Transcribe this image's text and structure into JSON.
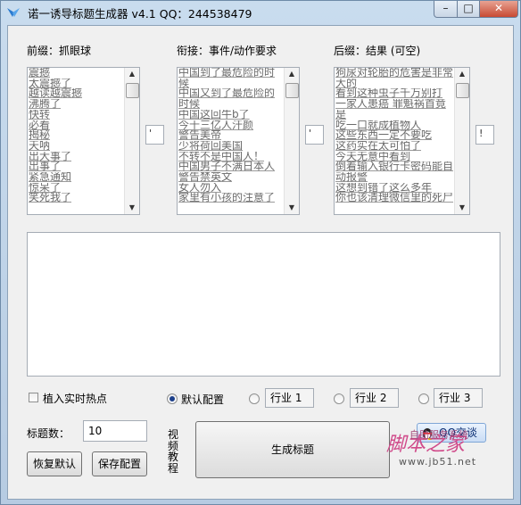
{
  "window": {
    "title": "诺一诱导标题生成器 v4.1    QQ：244538479",
    "close_glyph": "✕",
    "minimize_glyph": "–",
    "maximize_glyph": "□"
  },
  "prefix": {
    "label": "前缀：抓眼球",
    "items": [
      "震撼",
      "太震撼了",
      "越读越震撼",
      "沸腾了",
      "快转",
      "必看",
      "揭秘",
      "天呐",
      "出大事了",
      "出事了",
      "紧急通知",
      "惊呆了",
      "笑死我了"
    ],
    "side_value": "'"
  },
  "middle": {
    "label": "衔接：事件/动作要求",
    "items": [
      "中国到了最危险的时",
      "候",
      "中国又到了最危险的",
      "时候",
      "中国这回牛b了",
      "今十三亿人汗颜",
      "警告美帝",
      "少将荷回美国",
      "不转不是中国人！",
      "中国男子不满日本人",
      "警告禁英文",
      "女人勿入",
      "家里有小孩的注意了"
    ],
    "side_value": "'"
  },
  "suffix": {
    "label": "后缀：结果 (可空)",
    "items": [
      "狗尿对轮胎的危害是非常",
      "大的",
      "看到这种虫子千万别打",
      "一家人患癌 罪魁祸首竟",
      "是",
      "吃一口就成植物人",
      "这些东西一定不要吃",
      "这药实在太可怕了",
      "今天无意中看到",
      "倒着输入银行卡密码能自",
      "动报警",
      "这想到错了这么多年",
      "你也该清理微信里的死尸"
    ],
    "side_value": "!"
  },
  "options": {
    "realtime_hot": "植入实时热点",
    "default_config": "默认配置",
    "industry": [
      "行业 1",
      "行业 2",
      "行业 3"
    ]
  },
  "title_count": {
    "label": "标题数：",
    "value": "10"
  },
  "buttons": {
    "restore": "恢复默认",
    "save": "保存配置",
    "generate": "生成标题",
    "qq_chat": "QQ交谈"
  },
  "video_tutorial": "视频教程",
  "watermark": {
    "logo": "脚本之家",
    "tagline": "自助服务系统",
    "url": "www.jb51.net"
  }
}
